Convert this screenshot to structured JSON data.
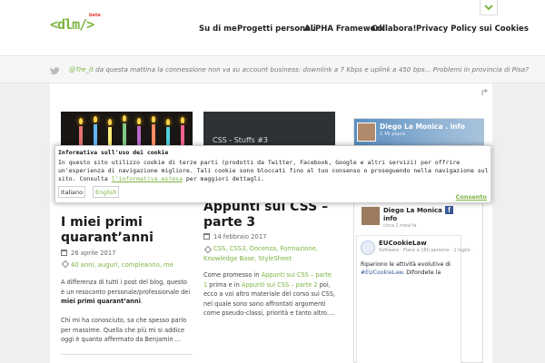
{
  "logo": {
    "text": "<dlm/>",
    "badge": "beta"
  },
  "nav": {
    "items": [
      "Su di me",
      "Progetti personali",
      "ALPHA Framework",
      "Collabora!",
      "Privacy Policy sui Cookies"
    ]
  },
  "tweet": {
    "handle": "@Tre_it",
    "text": " da questa mattina la connessione non va su account business: downlink a 7 Kbps e uplink a 450 bps... Problemi in provincia di Pisa?"
  },
  "posts": [
    {
      "title_line1": "I miei primi",
      "title_line2": "quarant’anni",
      "date": "26 aprile 2017",
      "tags": "40 anni, auguri, compleanno, me",
      "excerpt_a": "A differenza di tutti i post del blog, questo è un resoconto personale/professionale dei ",
      "excerpt_bold": "miei primi quarant’anni",
      "excerpt_b": ".",
      "excerpt_c": "Chi mi ha conosciuto, sa che spesso parlo per massime. Quella che più mi si addice oggi è quanto affermato da Benjamin …"
    },
    {
      "thumb_label": "CSS - Stuffs #3",
      "title_line1": "Appunti sui CSS –",
      "title_line2": "parte 3",
      "date": "14 febbraio 2017",
      "tags": "CSS, CSS3, Docenza, Formazione, Knowledge Base, StyleSheet",
      "excerpt_a": "Come promesso in ",
      "excerpt_link1": "Appunti sui CSS – parte 1",
      "excerpt_b": " prima e in ",
      "excerpt_link2": "Appunti sui CSS – parte 2",
      "excerpt_c": " poi, ecco a voi altro materiale del corso sui CSS, nel quale sono sono affrontati argomenti come pseudo-classi, priorità e tanto altro.…"
    }
  ],
  "facebook": {
    "cover_name": "Diego La Monica . info",
    "cover_sub": "1 Mi piace",
    "page_name": "Diego La Monica . info",
    "likes": "circa 2 mesi fa",
    "post_name": "EUCookieLaw",
    "post_sub": "Software · Piace a 180 persone · 1 luglio ·",
    "post_text_a": "Ripariono le attività evolutive di ",
    "post_hashtag": "#EUCookieLaw",
    "post_text_b": ". Difondete la"
  },
  "cookie": {
    "title": "Informativa sull'uso dei cookie",
    "body": "In questo sito utilizzo cookie di terze parti (prodotti da Twitter, Facebook, Google e altri servizi) per offrire un'esperienza di navigazione migliore. Tali cookie sono bloccati fino al tuo consenso o proseguendo nella navigazione sul sito. Consulta ",
    "link": "l'informativa estesa",
    "body_end": " per maggiori dettagli.",
    "lang_it": "Italiano",
    "lang_en": "English",
    "consent": "Consento"
  },
  "colors": {
    "accent": "#7cb342",
    "facebook": "#3b5998"
  },
  "icons": [
    "chevron-down-icon",
    "twitter-bird-icon",
    "calendar-icon",
    "tag-icon",
    "corner-expand-icon",
    "facebook-icon"
  ]
}
